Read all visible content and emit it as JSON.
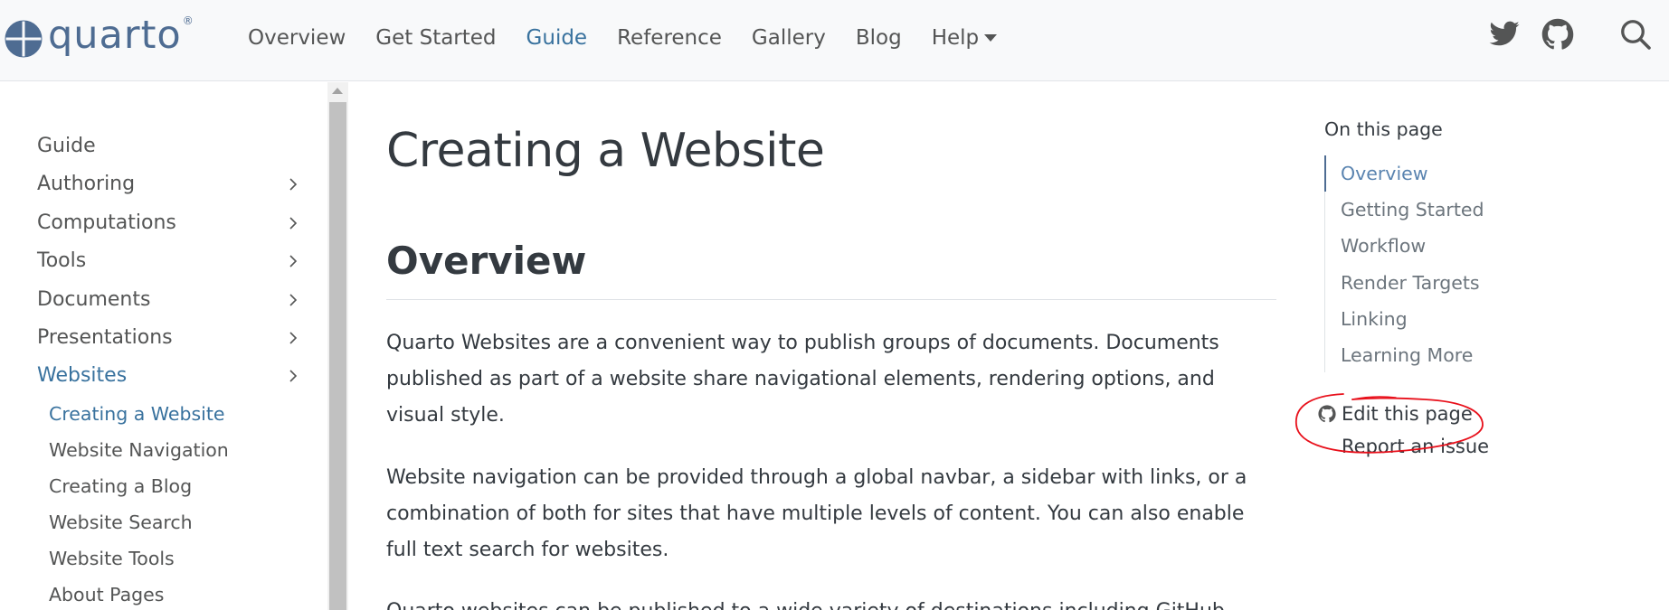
{
  "brand": {
    "name": "quarto",
    "reg": "®"
  },
  "navbar": {
    "links": [
      {
        "label": "Overview"
      },
      {
        "label": "Get Started"
      },
      {
        "label": "Guide",
        "active": true
      },
      {
        "label": "Reference"
      },
      {
        "label": "Gallery"
      },
      {
        "label": "Blog"
      },
      {
        "label": "Help"
      }
    ],
    "icons": [
      "twitter-icon",
      "github-icon",
      "search-icon"
    ]
  },
  "sidebar": {
    "items": [
      {
        "label": "Guide"
      },
      {
        "label": "Authoring"
      },
      {
        "label": "Computations"
      },
      {
        "label": "Tools"
      },
      {
        "label": "Documents"
      },
      {
        "label": "Presentations"
      },
      {
        "label": "Websites"
      }
    ],
    "subitems": [
      {
        "label": "Creating a Website"
      },
      {
        "label": "Website Navigation"
      },
      {
        "label": "Creating a Blog"
      },
      {
        "label": "Website Search"
      },
      {
        "label": "Website Tools"
      },
      {
        "label": "About Pages"
      }
    ]
  },
  "main": {
    "title": "Creating a Website",
    "section": "Overview",
    "paragraphs": [
      "Quarto Websites are a convenient way to publish groups of documents. Documents published as part of a website share navigational elements, rendering options, and visual style.",
      "Website navigation can be provided through a global navbar, a sidebar with links, or a combination of both for sites that have multiple levels of content. You can also enable full text search for websites.",
      "Quarto websites can be published to a wide variety of destinations including GitHub"
    ]
  },
  "toc": {
    "title": "On this page",
    "items": [
      {
        "label": "Overview"
      },
      {
        "label": "Getting Started"
      },
      {
        "label": "Workflow"
      },
      {
        "label": "Render Targets"
      },
      {
        "label": "Linking"
      },
      {
        "label": "Learning More"
      }
    ],
    "edit_label": "Edit this page",
    "issue_label": "Report an issue"
  },
  "colors": {
    "accent": "#39729e",
    "brand": "#4e6c92",
    "annotation": "#e8101b"
  }
}
